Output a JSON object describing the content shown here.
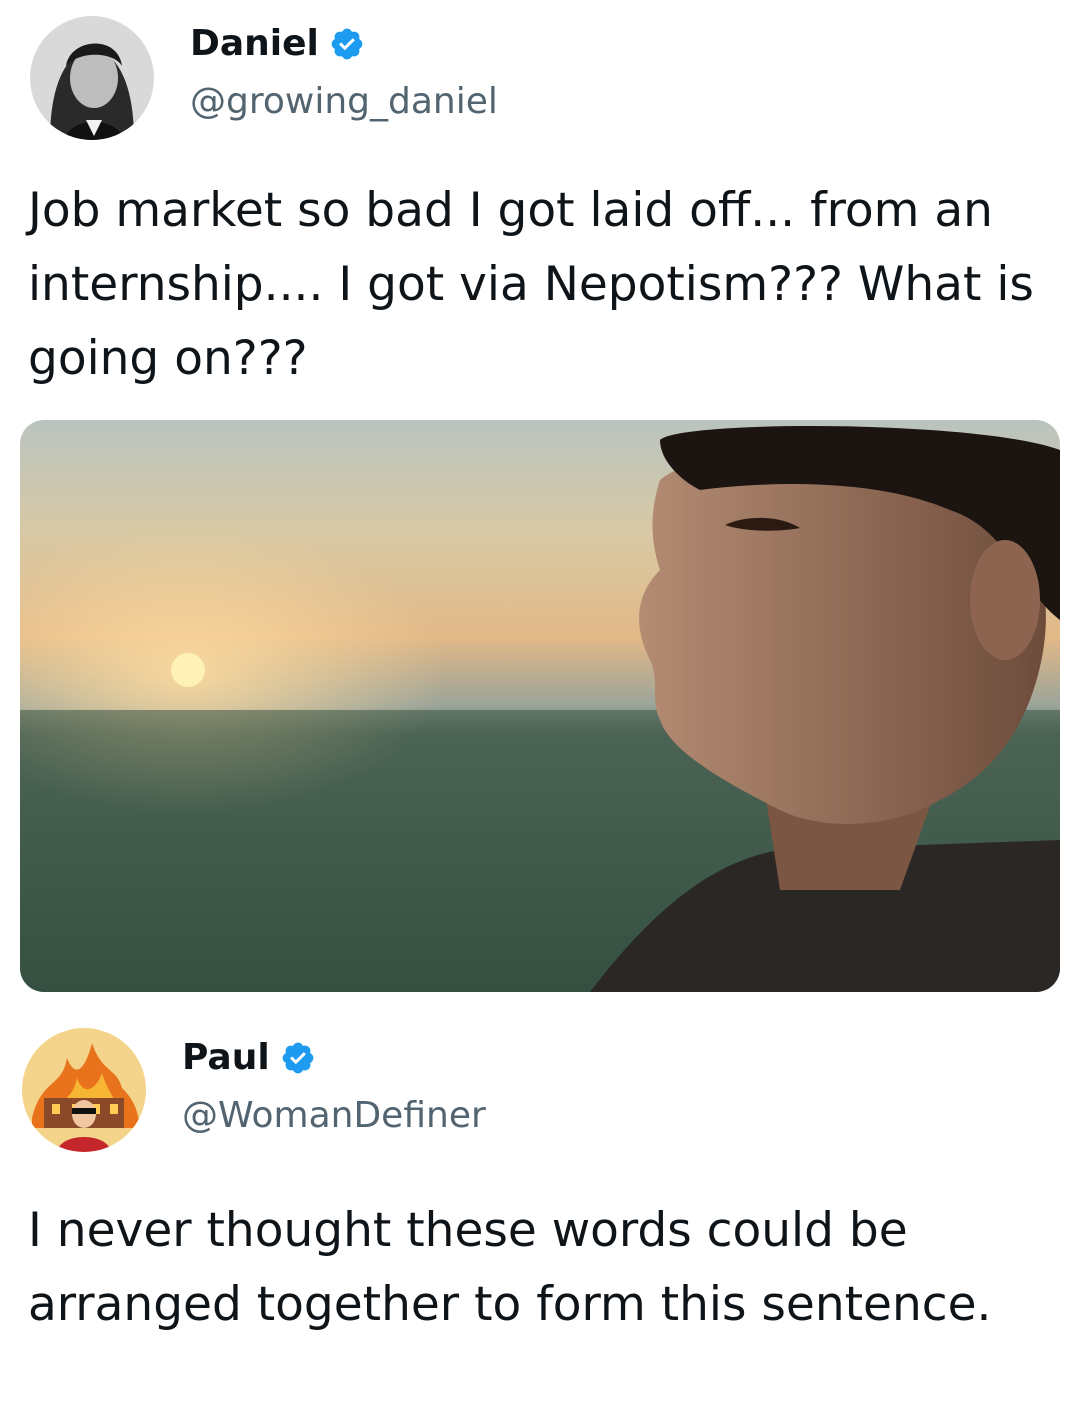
{
  "original_tweet": {
    "author_name": "Daniel",
    "author_handle": "@growing_daniel",
    "avatar_icon": "profile-photo-long-hair",
    "verified_icon": "verified-badge-icon",
    "text": "Job market so bad I got laid off... from an internship.... I got via Nepotism??? What is going on???",
    "media_icon": "photo-man-looking-at-sunset"
  },
  "reply_tweet": {
    "author_name": "Paul",
    "author_handle": "@WomanDefiner",
    "avatar_icon": "cartoon-avatar-burning-building",
    "verified_icon": "verified-badge-icon",
    "text": "I never thought these words could be arranged together to form this sentence."
  },
  "colors": {
    "verified_blue": "#1d9bf0",
    "handle_gray": "#536471",
    "text": "#0f1419",
    "background": "#ffffff"
  }
}
